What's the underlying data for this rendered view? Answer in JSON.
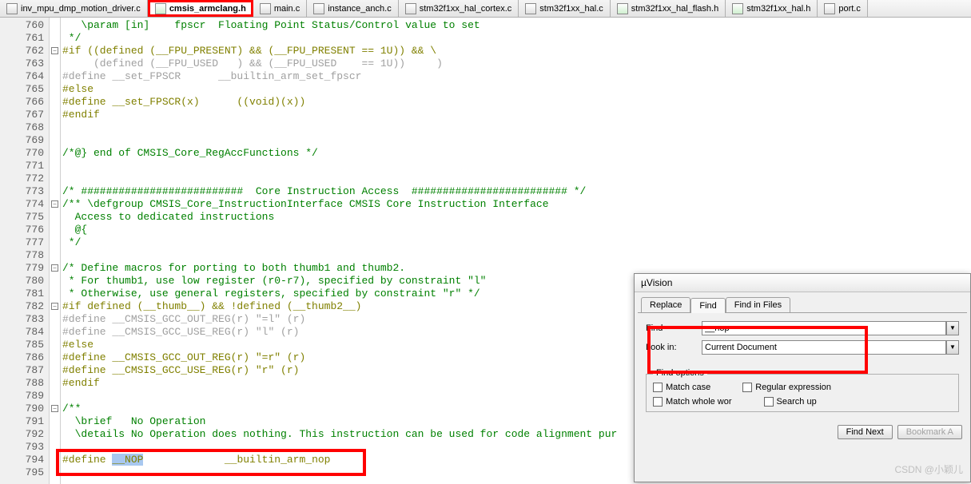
{
  "tabs": [
    {
      "label": "inv_mpu_dmp_motion_driver.c",
      "type": "c"
    },
    {
      "label": "cmsis_armclang.h",
      "type": "h",
      "active": true
    },
    {
      "label": "main.c",
      "type": "c"
    },
    {
      "label": "instance_anch.c",
      "type": "c"
    },
    {
      "label": "stm32f1xx_hal_cortex.c",
      "type": "c"
    },
    {
      "label": "stm32f1xx_hal.c",
      "type": "c"
    },
    {
      "label": "stm32f1xx_hal_flash.h",
      "type": "h"
    },
    {
      "label": "stm32f1xx_hal.h",
      "type": "h"
    },
    {
      "label": "port.c",
      "type": "c"
    }
  ],
  "lines": {
    "start": 760,
    "end": 795
  },
  "code_lines": [
    {
      "n": 760,
      "cls": "c-comment",
      "txt": "   \\param [in]    fpscr  Floating Point Status/Control value to set"
    },
    {
      "n": 761,
      "cls": "c-comment",
      "txt": " */"
    },
    {
      "n": 762,
      "cls": "c-preproc",
      "txt": "#if ((defined (__FPU_PRESENT) && (__FPU_PRESENT == 1U)) && \\",
      "fold": "-"
    },
    {
      "n": 763,
      "cls": "c-preproc-gray",
      "txt": "     (defined (__FPU_USED   ) && (__FPU_USED    == 1U))     )"
    },
    {
      "n": 764,
      "cls": "c-preproc-gray",
      "txt": "#define __set_FPSCR      __builtin_arm_set_fpscr"
    },
    {
      "n": 765,
      "cls": "c-preproc",
      "txt": "#else"
    },
    {
      "n": 766,
      "cls": "c-preproc",
      "txt": "#define __set_FPSCR(x)      ((void)(x))"
    },
    {
      "n": 767,
      "cls": "c-preproc",
      "txt": "#endif"
    },
    {
      "n": 768,
      "cls": "",
      "txt": ""
    },
    {
      "n": 769,
      "cls": "",
      "txt": ""
    },
    {
      "n": 770,
      "cls": "c-comment",
      "txt": "/*@} end of CMSIS_Core_RegAccFunctions */"
    },
    {
      "n": 771,
      "cls": "",
      "txt": ""
    },
    {
      "n": 772,
      "cls": "",
      "txt": ""
    },
    {
      "n": 773,
      "cls": "c-comment",
      "txt": "/* ##########################  Core Instruction Access  ######################### */"
    },
    {
      "n": 774,
      "cls": "c-comment",
      "txt": "/** \\defgroup CMSIS_Core_InstructionInterface CMSIS Core Instruction Interface",
      "fold": "-"
    },
    {
      "n": 775,
      "cls": "c-comment",
      "txt": "  Access to dedicated instructions"
    },
    {
      "n": 776,
      "cls": "c-comment",
      "txt": "  @{"
    },
    {
      "n": 777,
      "cls": "c-comment",
      "txt": " */"
    },
    {
      "n": 778,
      "cls": "",
      "txt": ""
    },
    {
      "n": 779,
      "cls": "c-comment",
      "txt": "/* Define macros for porting to both thumb1 and thumb2.",
      "fold": "-"
    },
    {
      "n": 780,
      "cls": "c-comment",
      "txt": " * For thumb1, use low register (r0-r7), specified by constraint \"l\""
    },
    {
      "n": 781,
      "cls": "c-comment",
      "txt": " * Otherwise, use general registers, specified by constraint \"r\" */"
    },
    {
      "n": 782,
      "cls": "c-preproc",
      "txt": "#if defined (__thumb__) && !defined (__thumb2__)",
      "fold": "-"
    },
    {
      "n": 783,
      "cls": "c-preproc-gray",
      "txt": "#define __CMSIS_GCC_OUT_REG(r) \"=l\" (r)"
    },
    {
      "n": 784,
      "cls": "c-preproc-gray",
      "txt": "#define __CMSIS_GCC_USE_REG(r) \"l\" (r)"
    },
    {
      "n": 785,
      "cls": "c-preproc",
      "txt": "#else"
    },
    {
      "n": 786,
      "cls": "c-preproc",
      "txt": "#define __CMSIS_GCC_OUT_REG(r) \"=r\" (r)"
    },
    {
      "n": 787,
      "cls": "c-preproc",
      "txt": "#define __CMSIS_GCC_USE_REG(r) \"r\" (r)"
    },
    {
      "n": 788,
      "cls": "c-preproc",
      "txt": "#endif"
    },
    {
      "n": 789,
      "cls": "",
      "txt": ""
    },
    {
      "n": 790,
      "cls": "c-comment",
      "txt": "/**",
      "fold": "-"
    },
    {
      "n": 791,
      "cls": "c-comment",
      "txt": "  \\brief   No Operation"
    },
    {
      "n": 792,
      "cls": "c-comment",
      "txt": "  \\details No Operation does nothing. This instruction can be used for code alignment pur"
    },
    {
      "n": 793,
      "cls": "",
      "txt": ""
    },
    {
      "n": 794,
      "cls": "c-preproc",
      "txt": "#define __NOP             __builtin_arm_nop",
      "sel": "__NOP"
    },
    {
      "n": 795,
      "cls": "",
      "txt": ""
    }
  ],
  "dialog": {
    "title": "µVision",
    "tabs": {
      "replace": "Replace",
      "find": "Find",
      "find_in_files": "Find in Files"
    },
    "find_label": "Find",
    "find_value": "__nop",
    "lookin_label": "Look in:",
    "lookin_value": "Current Document",
    "options_legend": "Find options",
    "match_case": "Match case",
    "regex": "Regular expression",
    "whole_word": "Match whole wor",
    "search_up": "Search up",
    "find_next": "Find Next",
    "bookmark": "Bookmark A"
  },
  "watermark": "CSDN @小颖儿"
}
